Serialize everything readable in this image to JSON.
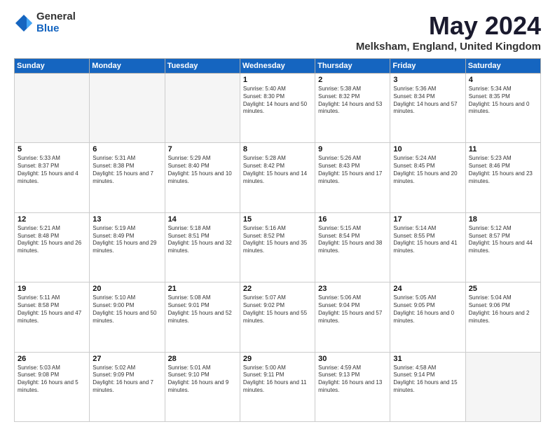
{
  "logo": {
    "general": "General",
    "blue": "Blue"
  },
  "title": "May 2024",
  "location": "Melksham, England, United Kingdom",
  "days_of_week": [
    "Sunday",
    "Monday",
    "Tuesday",
    "Wednesday",
    "Thursday",
    "Friday",
    "Saturday"
  ],
  "weeks": [
    [
      {
        "num": "",
        "empty": true
      },
      {
        "num": "",
        "empty": true
      },
      {
        "num": "",
        "empty": true
      },
      {
        "num": "1",
        "sunrise": "5:40 AM",
        "sunset": "8:30 PM",
        "daylight": "14 hours and 50 minutes."
      },
      {
        "num": "2",
        "sunrise": "5:38 AM",
        "sunset": "8:32 PM",
        "daylight": "14 hours and 53 minutes."
      },
      {
        "num": "3",
        "sunrise": "5:36 AM",
        "sunset": "8:34 PM",
        "daylight": "14 hours and 57 minutes."
      },
      {
        "num": "4",
        "sunrise": "5:34 AM",
        "sunset": "8:35 PM",
        "daylight": "15 hours and 0 minutes."
      }
    ],
    [
      {
        "num": "5",
        "sunrise": "5:33 AM",
        "sunset": "8:37 PM",
        "daylight": "15 hours and 4 minutes."
      },
      {
        "num": "6",
        "sunrise": "5:31 AM",
        "sunset": "8:38 PM",
        "daylight": "15 hours and 7 minutes."
      },
      {
        "num": "7",
        "sunrise": "5:29 AM",
        "sunset": "8:40 PM",
        "daylight": "15 hours and 10 minutes."
      },
      {
        "num": "8",
        "sunrise": "5:28 AM",
        "sunset": "8:42 PM",
        "daylight": "15 hours and 14 minutes."
      },
      {
        "num": "9",
        "sunrise": "5:26 AM",
        "sunset": "8:43 PM",
        "daylight": "15 hours and 17 minutes."
      },
      {
        "num": "10",
        "sunrise": "5:24 AM",
        "sunset": "8:45 PM",
        "daylight": "15 hours and 20 minutes."
      },
      {
        "num": "11",
        "sunrise": "5:23 AM",
        "sunset": "8:46 PM",
        "daylight": "15 hours and 23 minutes."
      }
    ],
    [
      {
        "num": "12",
        "sunrise": "5:21 AM",
        "sunset": "8:48 PM",
        "daylight": "15 hours and 26 minutes."
      },
      {
        "num": "13",
        "sunrise": "5:19 AM",
        "sunset": "8:49 PM",
        "daylight": "15 hours and 29 minutes."
      },
      {
        "num": "14",
        "sunrise": "5:18 AM",
        "sunset": "8:51 PM",
        "daylight": "15 hours and 32 minutes."
      },
      {
        "num": "15",
        "sunrise": "5:16 AM",
        "sunset": "8:52 PM",
        "daylight": "15 hours and 35 minutes."
      },
      {
        "num": "16",
        "sunrise": "5:15 AM",
        "sunset": "8:54 PM",
        "daylight": "15 hours and 38 minutes."
      },
      {
        "num": "17",
        "sunrise": "5:14 AM",
        "sunset": "8:55 PM",
        "daylight": "15 hours and 41 minutes."
      },
      {
        "num": "18",
        "sunrise": "5:12 AM",
        "sunset": "8:57 PM",
        "daylight": "15 hours and 44 minutes."
      }
    ],
    [
      {
        "num": "19",
        "sunrise": "5:11 AM",
        "sunset": "8:58 PM",
        "daylight": "15 hours and 47 minutes."
      },
      {
        "num": "20",
        "sunrise": "5:10 AM",
        "sunset": "9:00 PM",
        "daylight": "15 hours and 50 minutes."
      },
      {
        "num": "21",
        "sunrise": "5:08 AM",
        "sunset": "9:01 PM",
        "daylight": "15 hours and 52 minutes."
      },
      {
        "num": "22",
        "sunrise": "5:07 AM",
        "sunset": "9:02 PM",
        "daylight": "15 hours and 55 minutes."
      },
      {
        "num": "23",
        "sunrise": "5:06 AM",
        "sunset": "9:04 PM",
        "daylight": "15 hours and 57 minutes."
      },
      {
        "num": "24",
        "sunrise": "5:05 AM",
        "sunset": "9:05 PM",
        "daylight": "16 hours and 0 minutes."
      },
      {
        "num": "25",
        "sunrise": "5:04 AM",
        "sunset": "9:06 PM",
        "daylight": "16 hours and 2 minutes."
      }
    ],
    [
      {
        "num": "26",
        "sunrise": "5:03 AM",
        "sunset": "9:08 PM",
        "daylight": "16 hours and 5 minutes."
      },
      {
        "num": "27",
        "sunrise": "5:02 AM",
        "sunset": "9:09 PM",
        "daylight": "16 hours and 7 minutes."
      },
      {
        "num": "28",
        "sunrise": "5:01 AM",
        "sunset": "9:10 PM",
        "daylight": "16 hours and 9 minutes."
      },
      {
        "num": "29",
        "sunrise": "5:00 AM",
        "sunset": "9:11 PM",
        "daylight": "16 hours and 11 minutes."
      },
      {
        "num": "30",
        "sunrise": "4:59 AM",
        "sunset": "9:13 PM",
        "daylight": "16 hours and 13 minutes."
      },
      {
        "num": "31",
        "sunrise": "4:58 AM",
        "sunset": "9:14 PM",
        "daylight": "16 hours and 15 minutes."
      },
      {
        "num": "",
        "empty": true
      }
    ]
  ]
}
